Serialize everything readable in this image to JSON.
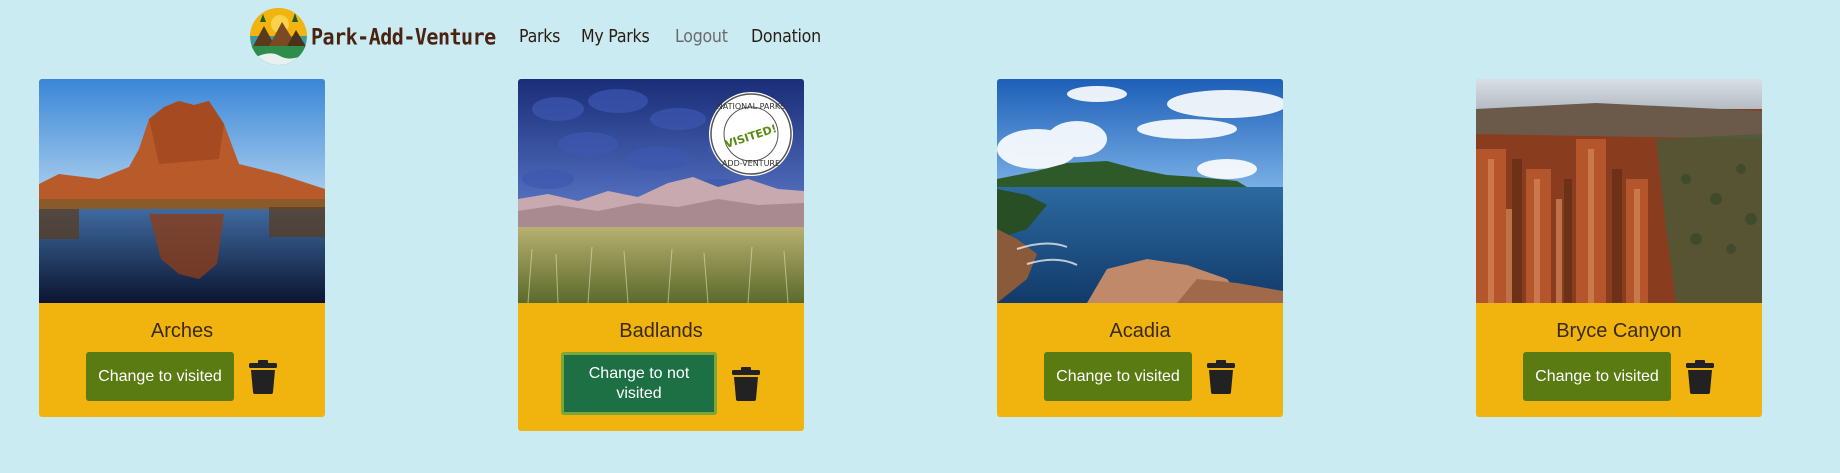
{
  "brand": {
    "name": "Park-Add-Venture"
  },
  "nav": {
    "items": [
      {
        "label": "Parks",
        "muted": false
      },
      {
        "label": "My Parks",
        "muted": false
      },
      {
        "label": "Logout",
        "muted": true
      },
      {
        "label": "Donation",
        "muted": false
      }
    ]
  },
  "stamp": {
    "top": "NATIONAL PARKS",
    "middle": "VISITED!",
    "bottom": "ADD-VENTURE"
  },
  "cards": [
    {
      "name": "Arches",
      "button": "Change to visited"
    },
    {
      "name": "Badlands",
      "button": "Change to not visited"
    },
    {
      "name": "Acadia",
      "button": "Change to visited"
    },
    {
      "name": "Bryce Canyon",
      "button": "Change to visited"
    }
  ],
  "colors": {
    "background": "#cbebf2",
    "card": "#f1b30e",
    "button": "#5a7a12",
    "button_active": "#1c7044",
    "brand_text": "#4a2212"
  },
  "icons": {
    "delete": "trash-icon",
    "logo": "park-logo-icon"
  }
}
